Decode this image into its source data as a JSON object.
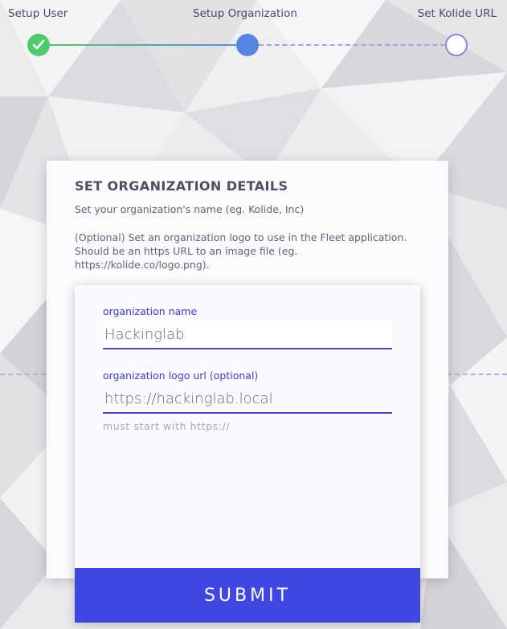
{
  "stepper": {
    "steps": [
      {
        "label": "Setup User",
        "state": "done"
      },
      {
        "label": "Setup Organization",
        "state": "current"
      },
      {
        "label": "Set Kolide URL",
        "state": "todo"
      }
    ]
  },
  "info": {
    "title": "SET ORGANIZATION DETAILS",
    "name_hint": "Set your organization's name (eg. Kolide, Inc)",
    "logo_hint": "(Optional) Set an organization logo to use in the Fleet application. Should be an https URL to an image file (eg. https://kolide.co/logo.png)."
  },
  "form": {
    "org_name": {
      "label": "organization name",
      "value": "Hackinglab"
    },
    "logo_url": {
      "label": "organization logo url (optional)",
      "value": "https://hackinglab.local",
      "hint": "must start with https://"
    },
    "submit_label": "SUBMIT"
  },
  "colors": {
    "accent": "#4046e0",
    "step_done": "#4fcb6c",
    "step_current": "#5a84e2",
    "step_todo_border": "#9b7fe0"
  },
  "icons": {
    "step_done": "check-icon"
  }
}
